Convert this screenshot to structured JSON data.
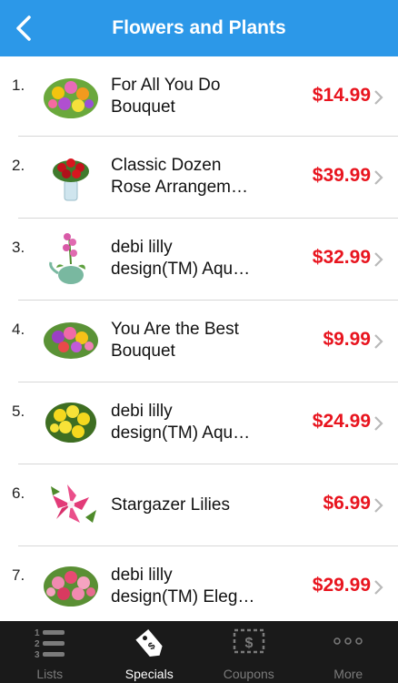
{
  "header": {
    "title": "Flowers and Plants",
    "back_icon": "chevron-left-icon"
  },
  "colors": {
    "header_bg": "#2c98e8",
    "price": "#e8141e",
    "tabbar_bg": "#1a1a1a"
  },
  "items": [
    {
      "rank": "1.",
      "line1": "For All You Do",
      "line2": "Bouquet",
      "price": "$14.99"
    },
    {
      "rank": "2.",
      "line1": "Classic Dozen",
      "line2": "Rose Arrangem…",
      "price": "$39.99"
    },
    {
      "rank": "3.",
      "line1": "debi lilly",
      "line2": "design(TM) Aqu…",
      "price": "$32.99"
    },
    {
      "rank": "4.",
      "line1": "You Are the Best",
      "line2": "Bouquet",
      "price": "$9.99"
    },
    {
      "rank": "5.",
      "line1": "debi lilly",
      "line2": "design(TM) Aqu…",
      "price": "$24.99"
    },
    {
      "rank": "6.",
      "line1": "Stargazer Lilies",
      "line2": "",
      "price": "$6.99"
    },
    {
      "rank": "7.",
      "line1": "debi lilly",
      "line2": "design(TM) Eleg…",
      "price": "$29.99"
    }
  ],
  "tabs": [
    {
      "label": "Lists",
      "icon": "numbered-list-icon",
      "active": false
    },
    {
      "label": "Specials",
      "icon": "price-tag-icon",
      "active": true
    },
    {
      "label": "Coupons",
      "icon": "coupon-icon",
      "active": false
    },
    {
      "label": "More",
      "icon": "more-dots-icon",
      "active": false
    }
  ]
}
